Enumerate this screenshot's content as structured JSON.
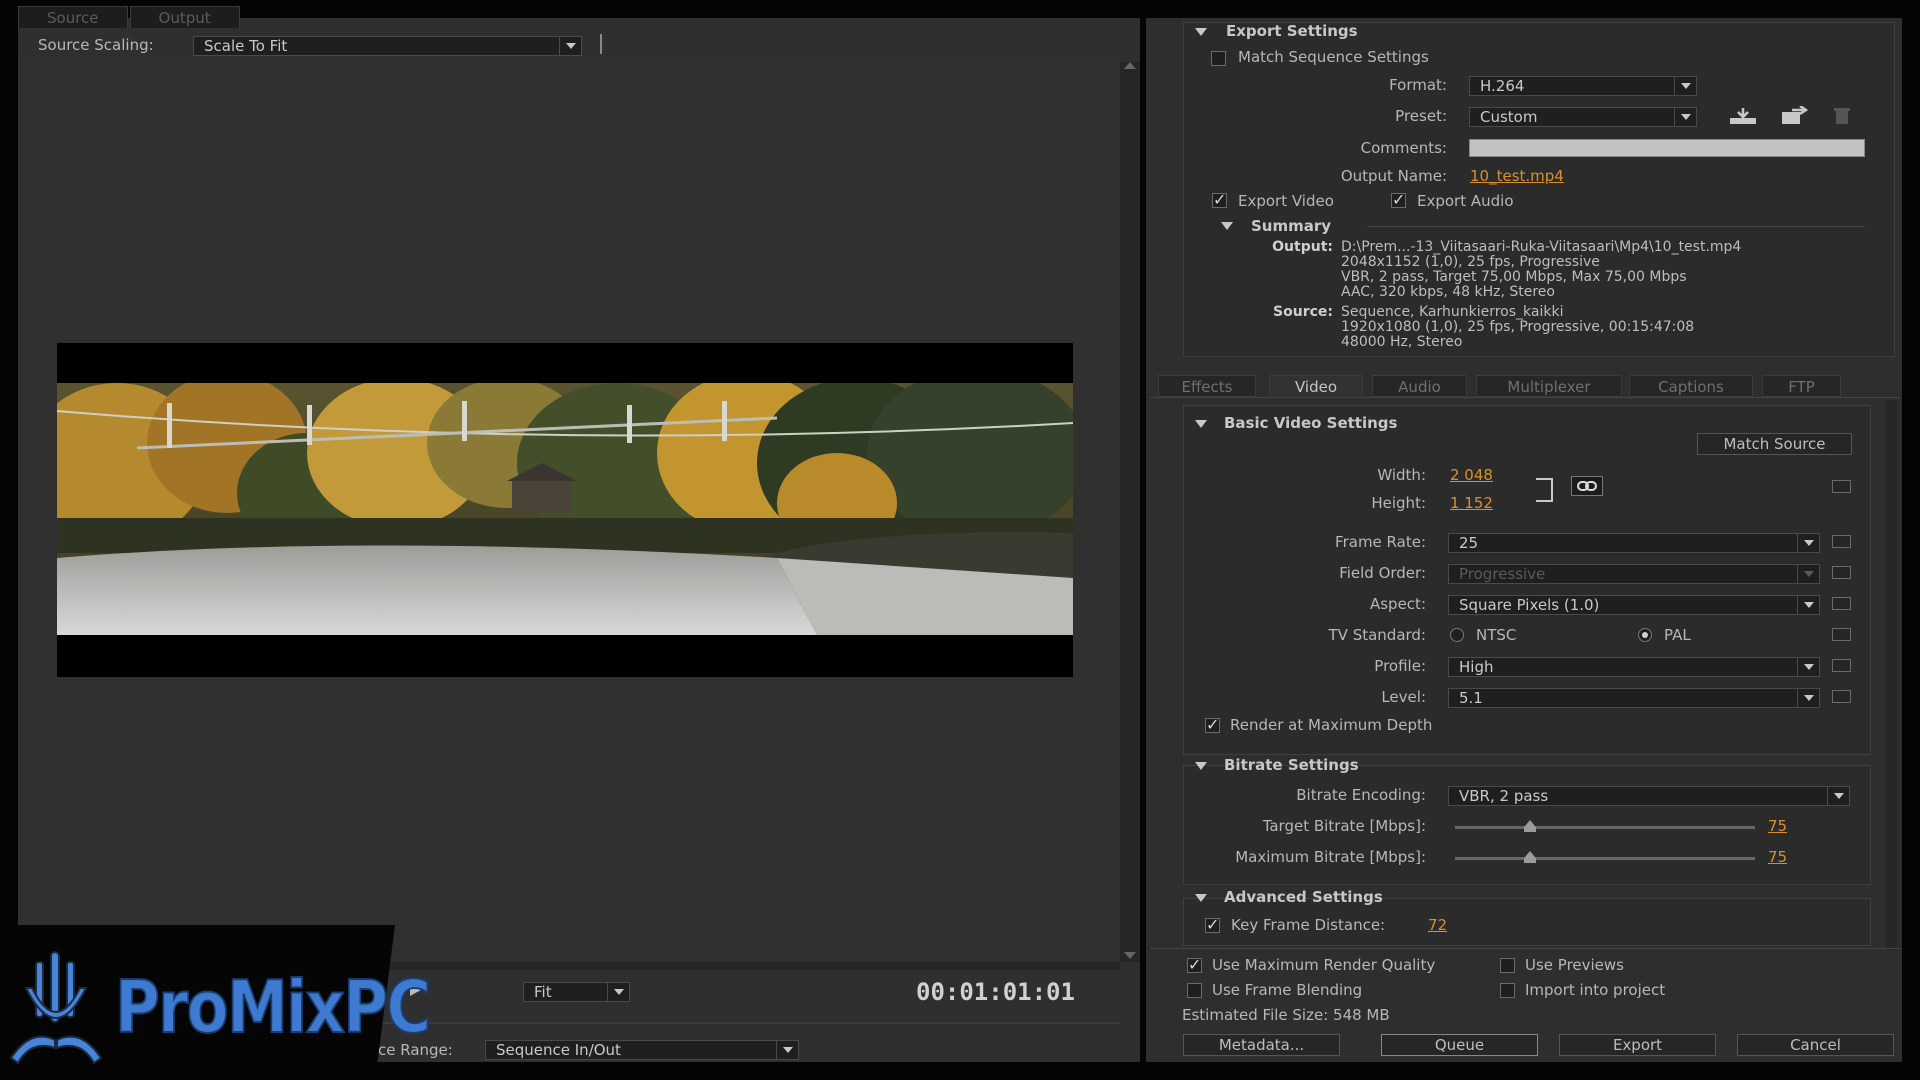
{
  "source_tabs": [
    "Source",
    "Output"
  ],
  "source_scaling": {
    "label": "Source Scaling:",
    "value": "Scale To Fit"
  },
  "timecode": "00:01:01:01",
  "fit": {
    "value": "Fit"
  },
  "source_range": {
    "label": "ce Range:",
    "value": "Sequence In/Out"
  },
  "watermark": {
    "text": "ProMixPC"
  },
  "export_settings": {
    "title": "Export Settings",
    "match_sequence": "Match Sequence Settings",
    "format_label": "Format:",
    "format_value": "H.264",
    "preset_label": "Preset:",
    "preset_value": "Custom",
    "comments_label": "Comments:",
    "comments_value": "",
    "output_name_label": "Output Name:",
    "output_name_value": "10_test.mp4",
    "export_video": "Export Video",
    "export_audio": "Export Audio"
  },
  "summary": {
    "title": "Summary",
    "output_label": "Output:",
    "output_lines": [
      "D:\\Prem...-13_Viitasaari-Ruka-Viitasaari\\Mp4\\10_test.mp4",
      "2048x1152 (1,0), 25 fps, Progressive",
      "VBR, 2 pass, Target 75,00 Mbps, Max 75,00 Mbps",
      "AAC, 320 kbps, 48 kHz, Stereo"
    ],
    "source_label": "Source:",
    "source_lines": [
      "Sequence, Karhunkierros_kaikki",
      "1920x1080 (1,0), 25 fps, Progressive, 00:15:47:08",
      "48000 Hz, Stereo"
    ]
  },
  "tabs": [
    "Effects",
    "Video",
    "Audio",
    "Multiplexer",
    "Captions",
    "FTP"
  ],
  "basic_video": {
    "title": "Basic Video Settings",
    "match_source": "Match Source",
    "width_label": "Width:",
    "width_value": "2 048",
    "height_label": "Height:",
    "height_value": "1 152",
    "frame_rate_label": "Frame Rate:",
    "frame_rate_value": "25",
    "field_order_label": "Field Order:",
    "field_order_value": "Progressive",
    "aspect_label": "Aspect:",
    "aspect_value": "Square Pixels (1.0)",
    "tv_standard_label": "TV Standard:",
    "ntsc": "NTSC",
    "pal": "PAL",
    "profile_label": "Profile:",
    "profile_value": "High",
    "level_label": "Level:",
    "level_value": "5.1",
    "render_max_depth": "Render at Maximum Depth"
  },
  "bitrate": {
    "title": "Bitrate Settings",
    "encoding_label": "Bitrate Encoding:",
    "encoding_value": "VBR, 2 pass",
    "target_label": "Target Bitrate [Mbps]:",
    "target_value": "75",
    "target_fraction": 0.25,
    "max_label": "Maximum Bitrate [Mbps]:",
    "max_value": "75",
    "max_fraction": 0.25
  },
  "advanced": {
    "title": "Advanced Settings",
    "key_frame_label": "Key Frame Distance:",
    "key_frame_value": "72"
  },
  "footer": {
    "use_max_render": "Use Maximum Render Quality",
    "use_previews": "Use Previews",
    "use_frame_blending": "Use Frame Blending",
    "import_into_project": "Import into project",
    "estimated_size": "Estimated File Size:  548 MB",
    "metadata": "Metadata...",
    "queue": "Queue",
    "export": "Export",
    "cancel": "Cancel"
  },
  "colors": {
    "accent": "#d9902c",
    "panel": "#2f2f2f",
    "watermark": "#3f7ad1"
  }
}
